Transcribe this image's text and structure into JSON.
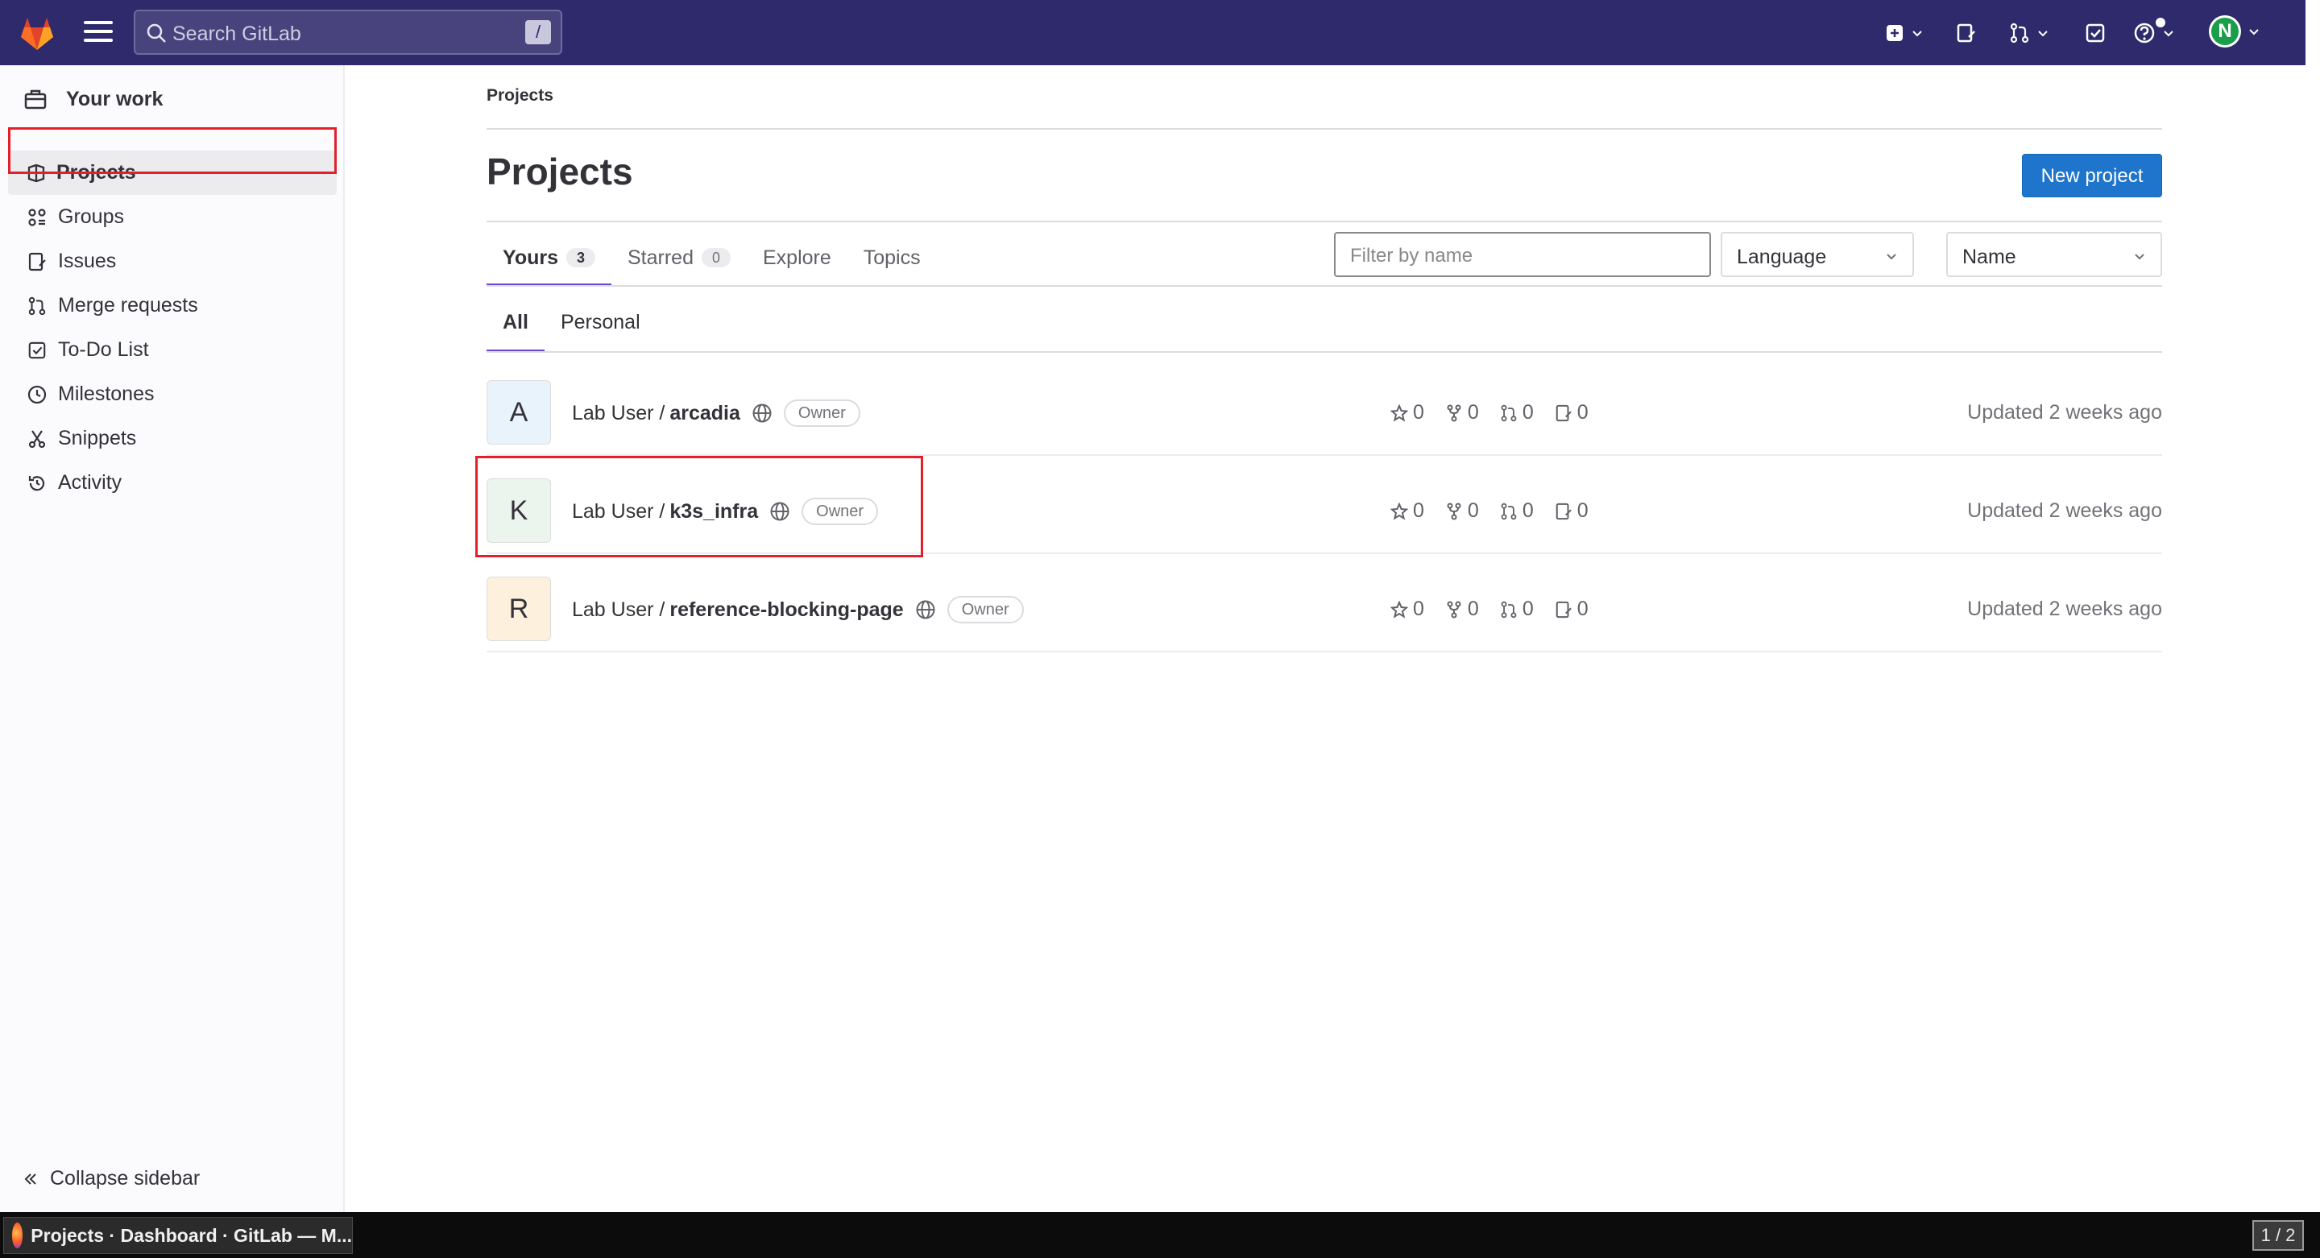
{
  "topbar": {
    "search_placeholder": "Search GitLab",
    "search_shortcut": "/",
    "avatar_initial": "N"
  },
  "sidebar": {
    "header": "Your work",
    "items": [
      {
        "label": "Projects",
        "icon": "project-icon",
        "active": true
      },
      {
        "label": "Groups",
        "icon": "group-icon"
      },
      {
        "label": "Issues",
        "icon": "issues-icon"
      },
      {
        "label": "Merge requests",
        "icon": "merge-request-icon"
      },
      {
        "label": "To-Do List",
        "icon": "todo-icon"
      },
      {
        "label": "Milestones",
        "icon": "clock-icon"
      },
      {
        "label": "Snippets",
        "icon": "scissors-icon"
      },
      {
        "label": "Activity",
        "icon": "history-icon"
      }
    ],
    "collapse_label": "Collapse sidebar"
  },
  "main": {
    "breadcrumb": "Projects",
    "title": "Projects",
    "new_project_label": "New project",
    "tabs": [
      {
        "label": "Yours",
        "count": "3",
        "active": true
      },
      {
        "label": "Starred",
        "count": "0"
      },
      {
        "label": "Explore"
      },
      {
        "label": "Topics"
      }
    ],
    "filter_placeholder": "Filter by name",
    "language_select": "Language",
    "sort_select": "Name",
    "subtabs": [
      {
        "label": "All",
        "active": true
      },
      {
        "label": "Personal"
      }
    ],
    "projects": [
      {
        "initial": "A",
        "namespace": "Lab User /",
        "name": "arcadia",
        "role": "Owner",
        "stars": "0",
        "forks": "0",
        "mrs": "0",
        "issues": "0",
        "updated": "Updated 2 weeks ago",
        "avatar_color": "#e9f3fc"
      },
      {
        "initial": "K",
        "namespace": "Lab User /",
        "name": "k3s_infra",
        "role": "Owner",
        "stars": "0",
        "forks": "0",
        "mrs": "0",
        "issues": "0",
        "updated": "Updated 2 weeks ago",
        "avatar_color": "#ecf4ee"
      },
      {
        "initial": "R",
        "namespace": "Lab User /",
        "name": "reference-blocking-page",
        "role": "Owner",
        "stars": "0",
        "forks": "0",
        "mrs": "0",
        "issues": "0",
        "updated": "Updated 2 weeks ago",
        "avatar_color": "#fdf1dd"
      }
    ]
  },
  "taskbar": {
    "window_title": "Projects · Dashboard · GitLab — M...",
    "pager": "1 / 2"
  },
  "colors": {
    "navbar": "#2f2a6b",
    "accent": "#6e49cb",
    "primary_button": "#1f75cb",
    "highlight": "#e3202a"
  }
}
